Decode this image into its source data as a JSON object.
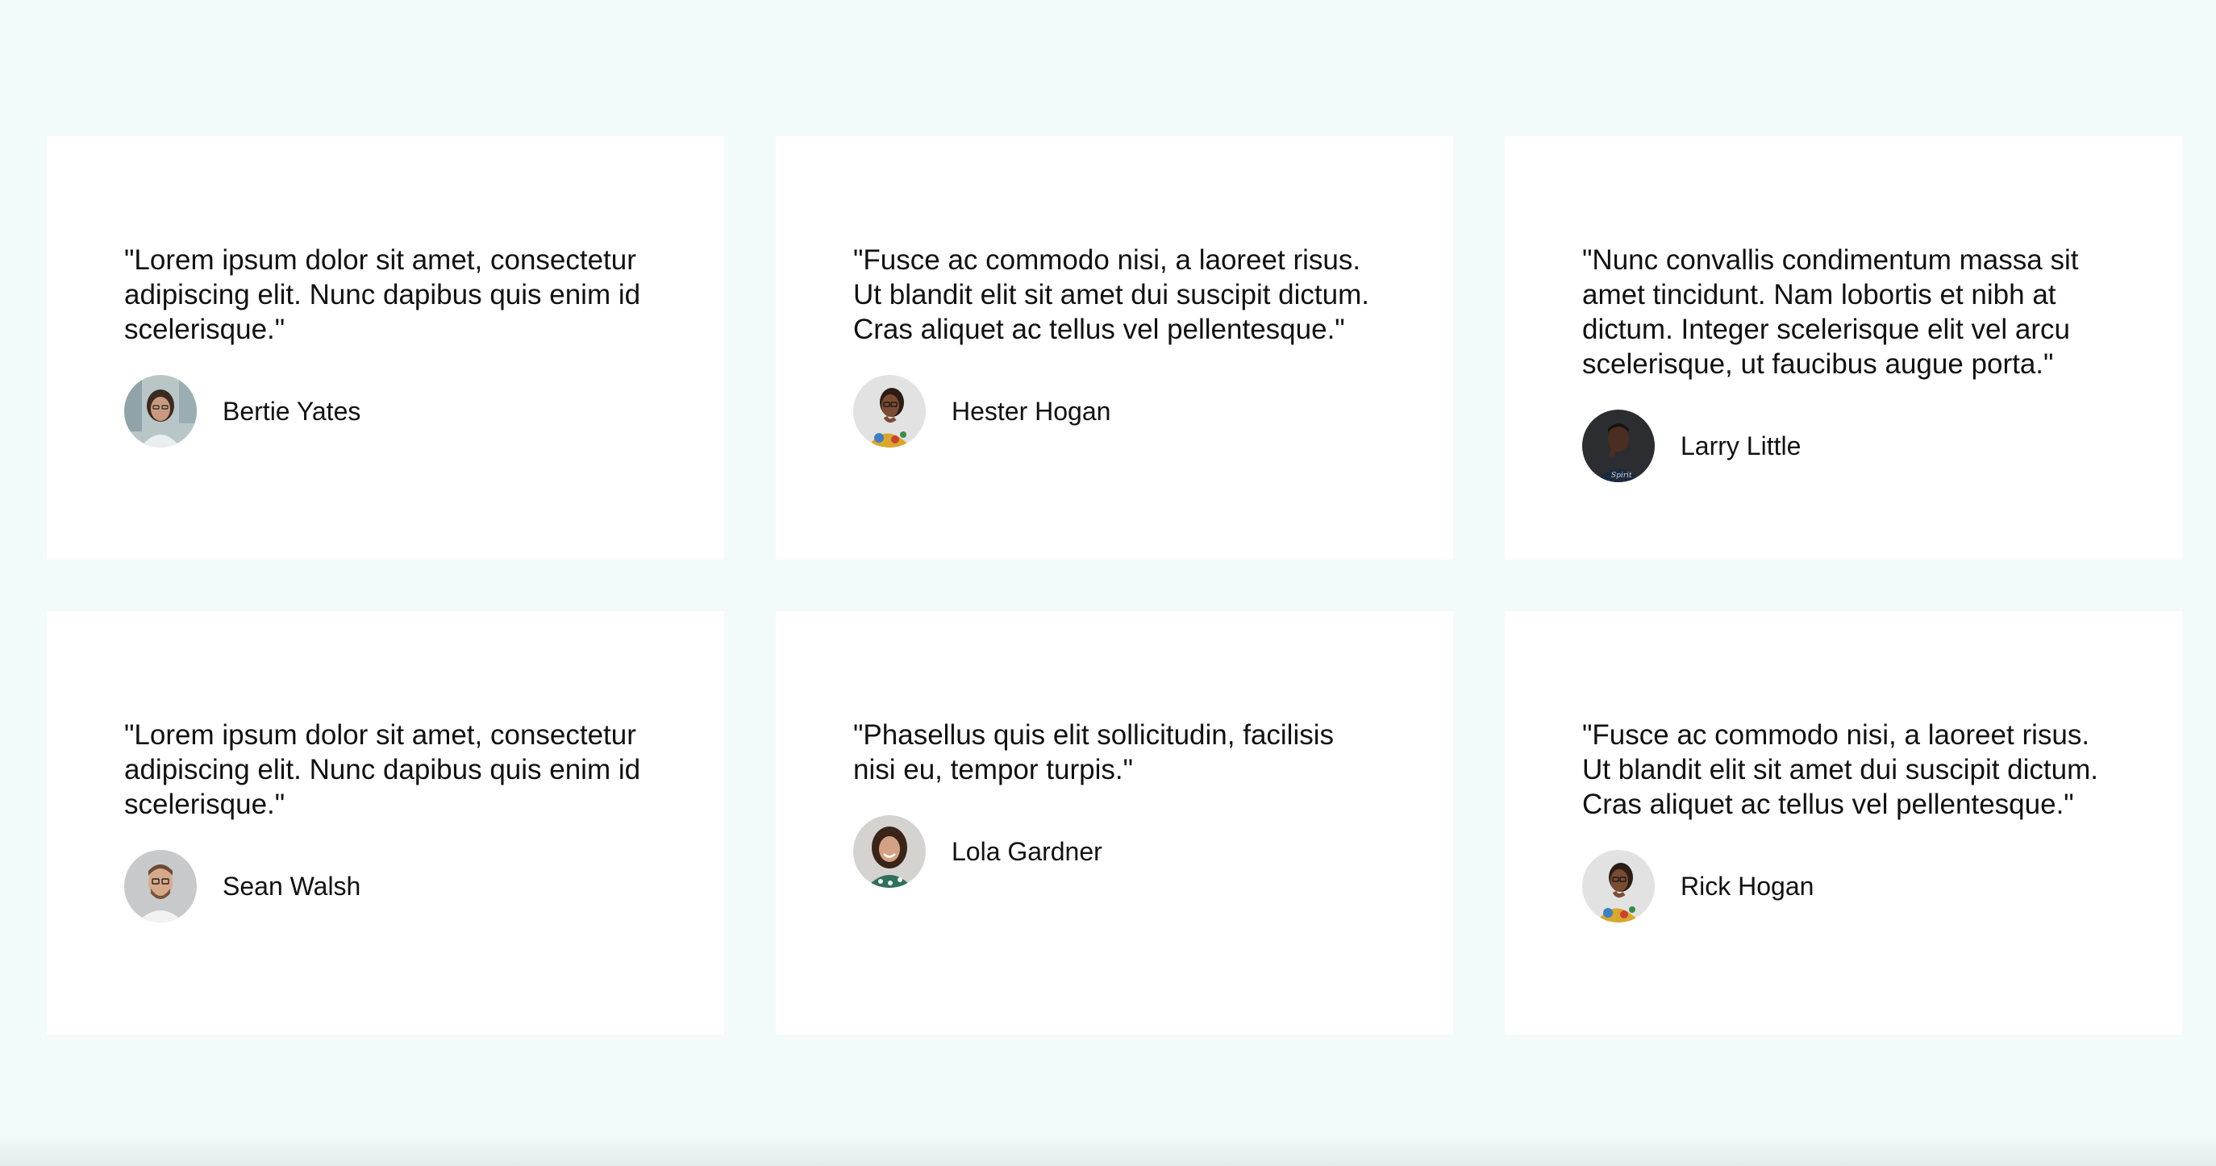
{
  "testimonials": [
    {
      "quote": "\"Lorem ipsum dolor sit amet, consectetur adipiscing elit. Nunc dapibus quis enim id scelerisque.\"",
      "name": "Bertie Yates",
      "avatar": "woman-with-glasses-avatar"
    },
    {
      "quote": "\"Fusce ac commodo nisi, a laoreet risus. Ut blandit elit sit amet dui suscipit dictum. Cras aliquet ac tellus vel pellentesque.\"",
      "name": "Hester Hogan",
      "avatar": "woman-in-floral-shirt-avatar"
    },
    {
      "quote": "\"Nunc convallis condimentum massa sit amet tincidunt. Nam lobortis et nibh at dictum. Integer scelerisque elit vel arcu scelerisque, ut faucibus augue porta.\"",
      "name": "Larry Little",
      "avatar": "man-dark-background-avatar"
    },
    {
      "quote": "\"Lorem ipsum dolor sit amet, consectetur adipiscing elit. Nunc dapibus quis enim id scelerisque.\"",
      "name": "Sean Walsh",
      "avatar": "man-with-glasses-avatar"
    },
    {
      "quote": "\"Phasellus quis elit sollicitudin, facilisis nisi eu, tempor turpis.\"",
      "name": "Lola Gardner",
      "avatar": "smiling-woman-avatar"
    },
    {
      "quote": "\"Fusce ac commodo nisi, a laoreet risus. Ut blandit elit sit amet dui suscipit dictum. Cras aliquet ac tellus vel pellentesque.\"",
      "name": "Rick Hogan",
      "avatar": "woman-in-floral-shirt-avatar"
    }
  ]
}
